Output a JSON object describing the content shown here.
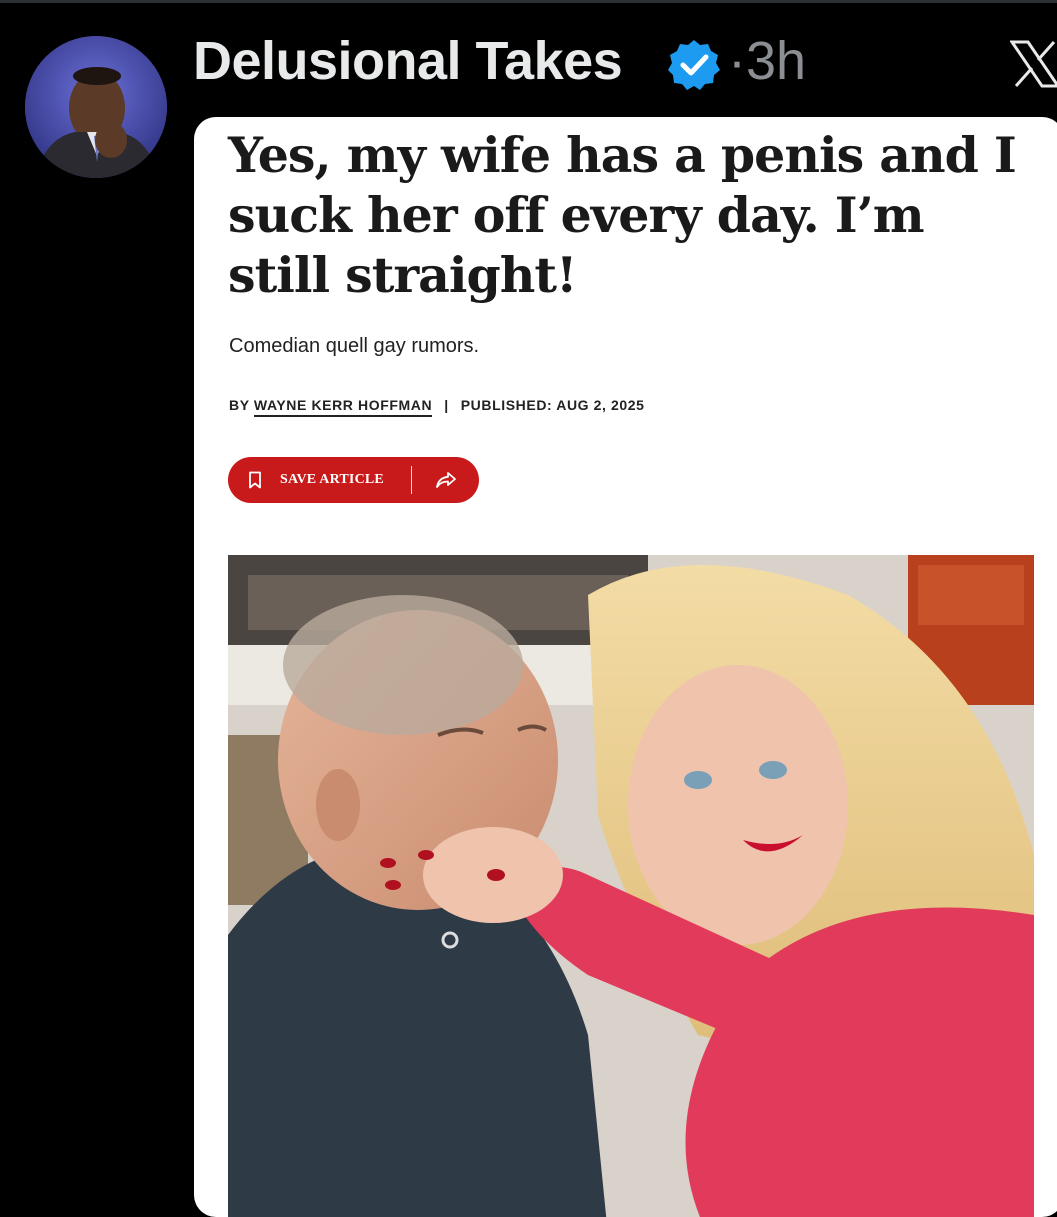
{
  "post": {
    "author_name": "Delusional Takes",
    "separator": "·",
    "time": "3h",
    "verified": true,
    "verified_color": "#1d9bf0"
  },
  "article": {
    "headline": "Yes, my wife has a penis and I suck her off every day. I’m still straight!",
    "dek": "Comedian quell gay rumors.",
    "byline_prefix": "BY",
    "author": "WAYNE KERR HOFFMAN",
    "byline_separator": "|",
    "published": "PUBLISHED: AUG 2, 2025",
    "save_label": "SAVE ARTICLE",
    "button_color": "#c81a1a"
  },
  "icons": {
    "verified": "verified-badge-icon",
    "app": "x-logo-icon",
    "save": "bookmark-icon",
    "share": "share-icon"
  }
}
